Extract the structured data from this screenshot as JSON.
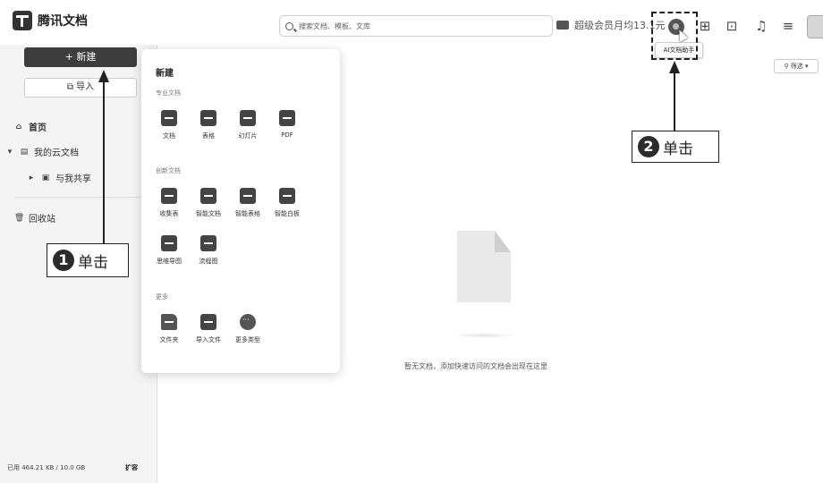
{
  "header": {
    "app_title": "腾讯文档",
    "search_placeholder": "搜索文档、模板、文库",
    "vip_text": "超级会员月均13.1元",
    "ai_tooltip": "AI文档助手",
    "icons": [
      "ai-assistant-icon",
      "apps-grid-icon",
      "video-icon",
      "bell-icon",
      "menu-icon",
      "avatar"
    ]
  },
  "sidebar": {
    "new_label": "+ 新建",
    "import_label": "导入",
    "items": [
      {
        "label": "首页",
        "icon": "home-icon"
      },
      {
        "label": "我的云文档",
        "icon": "doc-icon"
      },
      {
        "label": "与我共享",
        "icon": "folder-icon"
      },
      {
        "label": "回收站",
        "icon": "trash-icon"
      }
    ],
    "storage": "已用 464.21 KB / 10.0 GB",
    "expand": "扩容"
  },
  "panel": {
    "title": "新建",
    "sections": [
      {
        "title": "专业文档",
        "items": [
          "文档",
          "表格",
          "幻灯片",
          "PDF"
        ]
      },
      {
        "title": "创新文档",
        "items": [
          "收集表",
          "智能文档",
          "智能表格",
          "智能白板",
          "思维导图",
          "流程图"
        ]
      },
      {
        "title": "更多",
        "items": [
          "文件夹",
          "导入文件",
          "更多类型"
        ]
      }
    ]
  },
  "main": {
    "filter_label": "筛选",
    "empty_text": "暂无文档，添加快速访问的文档会出现在这里"
  },
  "annotations": {
    "callout1_num": "1",
    "callout1_text": "单击",
    "callout2_num": "2",
    "callout2_text": "单击"
  }
}
